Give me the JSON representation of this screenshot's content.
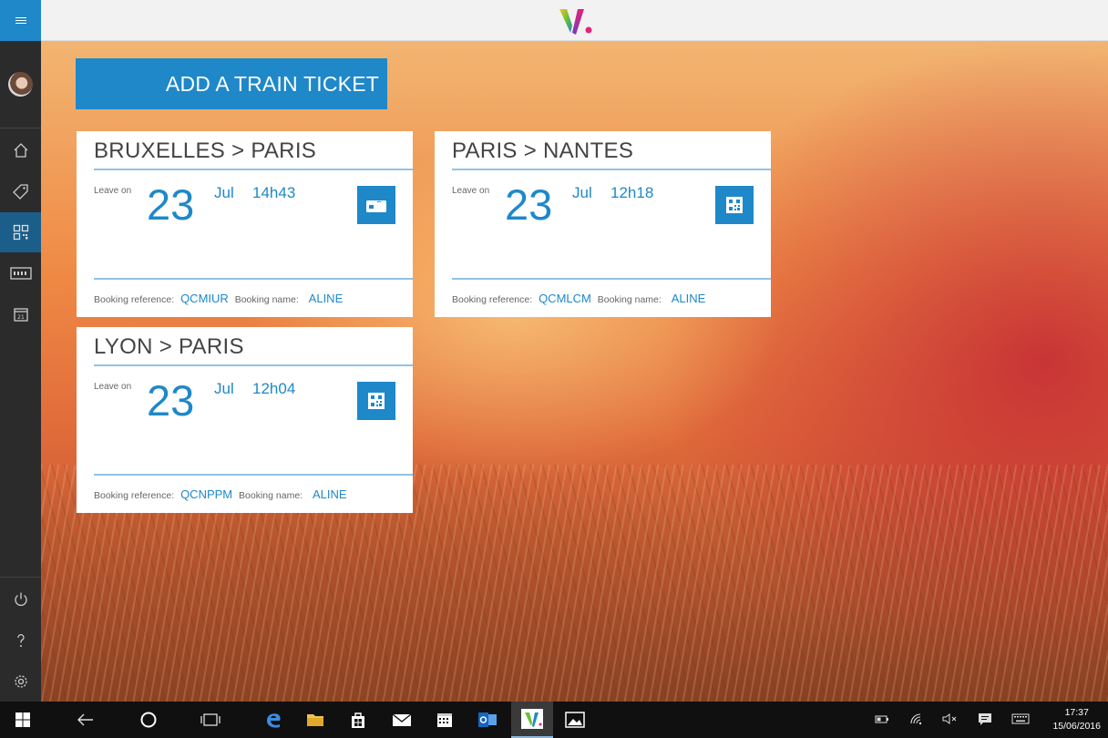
{
  "app": {
    "logo_icon": "v-logo-icon"
  },
  "sidebar": {
    "menu_icon": "hamburger-icon",
    "items": [
      {
        "icon": "home-icon"
      },
      {
        "icon": "tag-icon"
      },
      {
        "icon": "qr-code-icon",
        "active": true
      },
      {
        "icon": "card-icon"
      },
      {
        "icon": "calendar-icon"
      }
    ],
    "bottom_items": [
      {
        "icon": "power-icon"
      },
      {
        "icon": "help-icon"
      },
      {
        "icon": "gear-icon"
      }
    ]
  },
  "main": {
    "add_button_label": "ADD A TRAIN TICKET",
    "tickets": [
      {
        "route": "BRUXELLES > PARIS",
        "leave_label": "Leave on",
        "day": "23",
        "month": "Jul",
        "time": "14h43",
        "ticket_type_icon": "contactless-card-icon",
        "booking_ref_label": "Booking reference:",
        "booking_ref": "QCMIUR",
        "booking_name_label": "Booking name:",
        "booking_name": "ALINE"
      },
      {
        "route": "PARIS > NANTES",
        "leave_label": "Leave on",
        "day": "23",
        "month": "Jul",
        "time": "12h18",
        "ticket_type_icon": "qr-code-icon",
        "booking_ref_label": "Booking reference:",
        "booking_ref": "QCMLCM",
        "booking_name_label": "Booking name:",
        "booking_name": "ALINE"
      },
      {
        "route": "LYON > PARIS",
        "leave_label": "Leave on",
        "day": "23",
        "month": "Jul",
        "time": "12h04",
        "ticket_type_icon": "qr-code-icon",
        "booking_ref_label": "Booking reference:",
        "booking_ref": "QCNPPM",
        "booking_name_label": "Booking name:",
        "booking_name": "ALINE"
      }
    ]
  },
  "taskbar": {
    "apps": [
      "windows-start-icon",
      "back-arrow-icon",
      "cortana-icon",
      "task-view-icon",
      "edge-icon",
      "file-explorer-icon",
      "store-icon",
      "mail-icon",
      "calendar-icon",
      "outlook-icon",
      "v-app-icon",
      "photos-icon"
    ],
    "tray": [
      "battery-icon",
      "wifi-icon",
      "volume-muted-icon",
      "notifications-icon",
      "keyboard-icon"
    ],
    "time": "17:37",
    "date": "15/06/2016"
  },
  "colors": {
    "accent": "#1e88c9",
    "sidebar": "#2b2b2b",
    "taskbar": "#101010"
  }
}
